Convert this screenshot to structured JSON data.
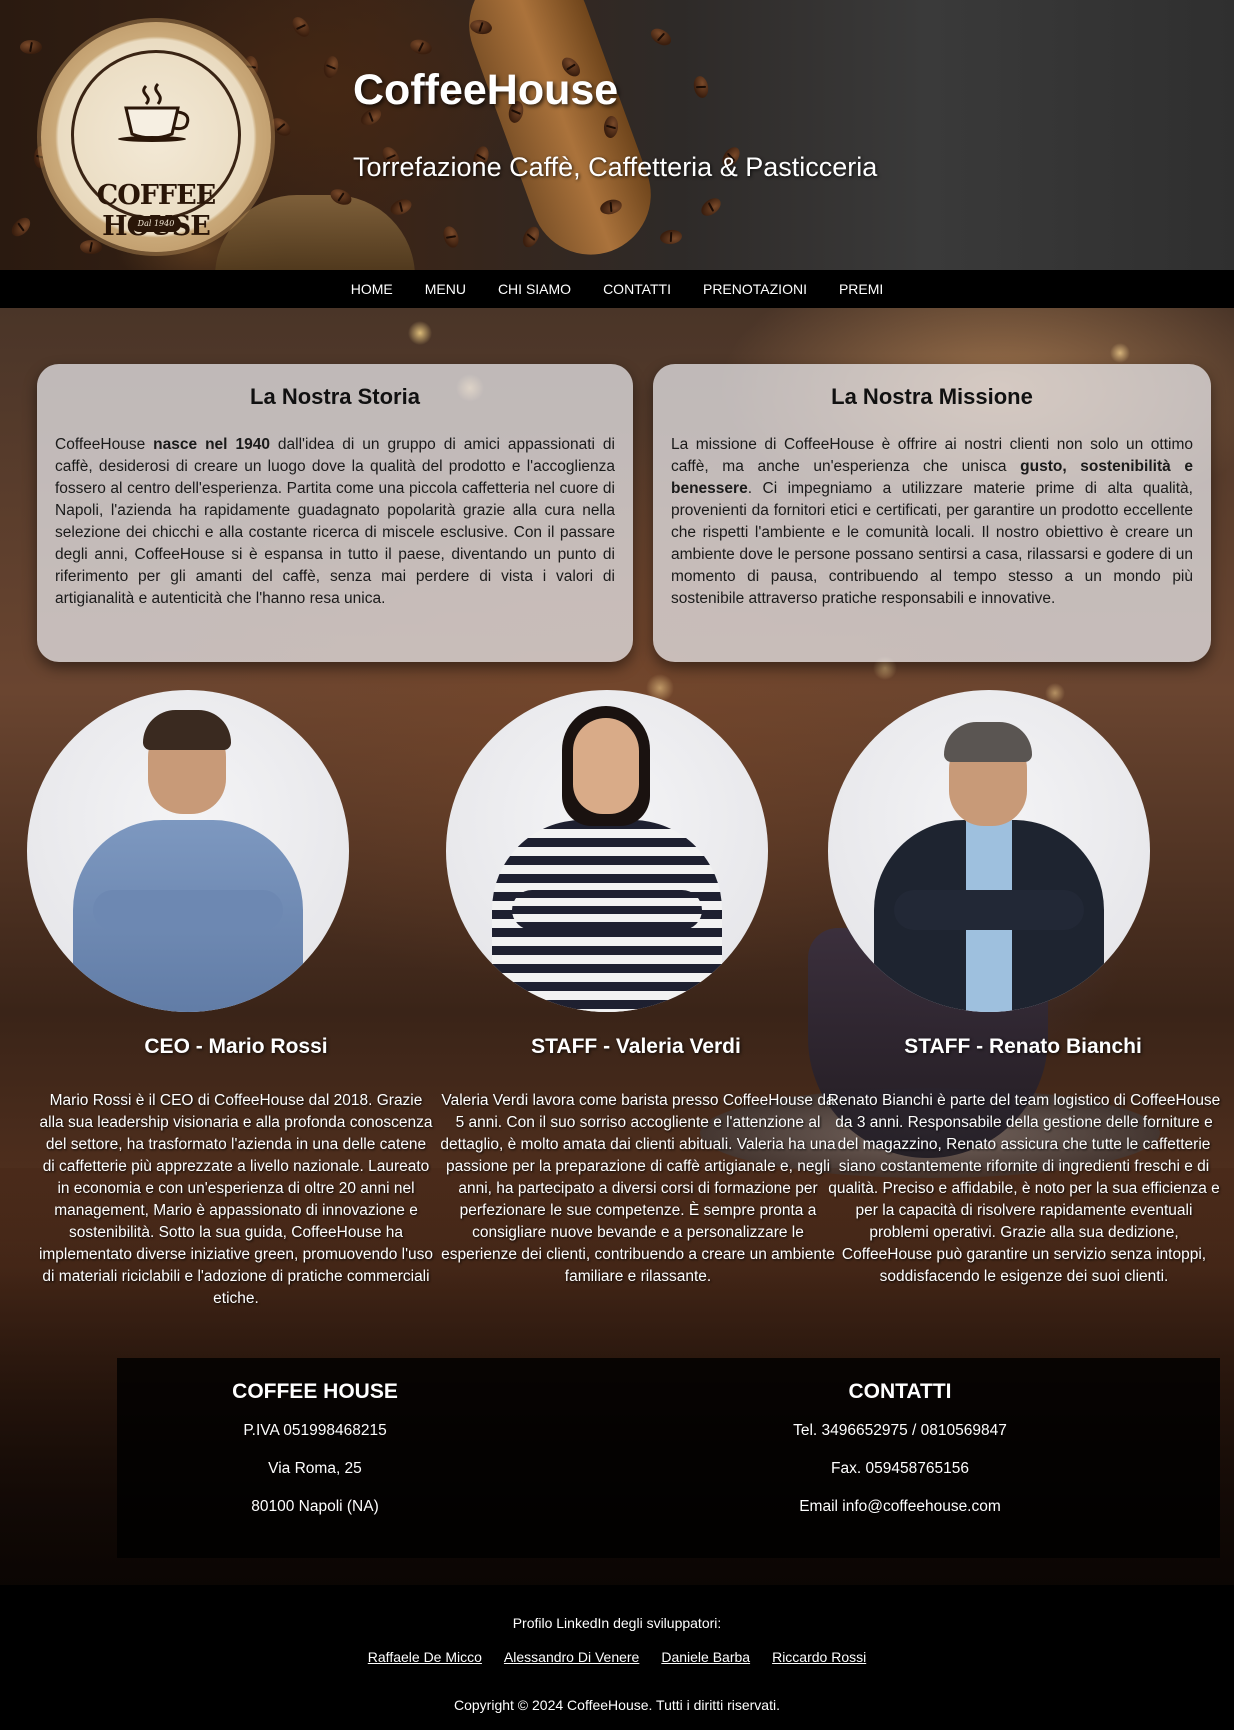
{
  "header": {
    "title": "CoffeeHouse",
    "subtitle": "Torrefazione Caffè, Caffetteria & Pasticceria",
    "logo_text": "COFFEE HOUSE",
    "logo_subtext": "Dal 1940"
  },
  "nav": {
    "items": [
      "HOME",
      "MENU",
      "CHI SIAMO",
      "CONTATTI",
      "PRENOTAZIONI",
      "PREMI"
    ]
  },
  "story": {
    "title": "La Nostra Storia",
    "text_before": "CoffeeHouse ",
    "text_bold": "nasce nel 1940",
    "text_after": " dall'idea di un gruppo di amici appassionati di caffè, desiderosi di creare un luogo dove la qualità del prodotto e l'accoglienza fossero al centro dell'esperienza. Partita come una piccola caffetteria nel cuore di Napoli, l'azienda ha rapidamente guadagnato popolarità grazie alla cura nella selezione dei chicchi e alla costante ricerca di miscele esclusive. Con il passare degli anni, CoffeeHouse si è espansa in tutto il paese, diventando un punto di riferimento per gli amanti del caffè, senza mai perdere di vista i valori di artigianalità e autenticità che l'hanno resa unica."
  },
  "mission": {
    "title": "La Nostra Missione",
    "text_before": "La missione di CoffeeHouse è offrire ai nostri clienti non solo un ottimo caffè, ma anche un'esperienza che unisca ",
    "text_bold": "gusto, sostenibilità e benessere",
    "text_after": ". Ci impegniamo a utilizzare materie prime di alta qualità, provenienti da fornitori etici e certificati, per garantire un prodotto eccellente che rispetti l'ambiente e le comunità locali. Il nostro obiettivo è creare un ambiente dove le persone possano sentirsi a casa, rilassarsi e godere di un momento di pausa, contribuendo al tempo stesso a un mondo più sostenibile attraverso pratiche responsabili e innovative."
  },
  "team": [
    {
      "name": "CEO - Mario Rossi",
      "description": "Mario Rossi è il CEO di CoffeeHouse dal 2018. Grazie alla sua leadership visionaria e alla profonda conoscenza del settore, ha trasformato l'azienda in una delle catene di caffetterie più apprezzate a livello nazionale. Laureato in economia e con un'esperienza di oltre 20 anni nel management, Mario è appassionato di innovazione e sostenibilità. Sotto la sua guida, CoffeeHouse ha implementato diverse iniziative green, promuovendo l'uso di materiali riciclabili e l'adozione di pratiche commerciali etiche."
    },
    {
      "name": "STAFF - Valeria Verdi",
      "description": "Valeria Verdi lavora come barista presso CoffeeHouse da 5 anni. Con il suo sorriso accogliente e l'attenzione al dettaglio, è molto amata dai clienti abituali. Valeria ha una passione per la preparazione di caffè artigianale e, negli anni, ha partecipato a diversi corsi di formazione per perfezionare le sue competenze. È sempre pronta a consigliare nuove bevande e a personalizzare le esperienze dei clienti, contribuendo a creare un ambiente familiare e rilassante."
    },
    {
      "name": "STAFF - Renato Bianchi",
      "description": "Renato Bianchi è parte del team logistico di CoffeeHouse da 3 anni. Responsabile della gestione delle forniture e del magazzino, Renato assicura che tutte le caffetterie siano costantemente rifornite di ingredienti freschi e di qualità. Preciso e affidabile, è noto per la sua efficienza e per la capacità di risolvere rapidamente eventuali problemi operativi. Grazie alla sua dedizione, CoffeeHouse può garantire un servizio senza intoppi, soddisfacendo le esigenze dei suoi clienti."
    }
  ],
  "company": {
    "title": "COFFEE HOUSE",
    "lines": [
      "P.IVA 051998468215",
      "Via Roma, 25",
      "80100 Napoli (NA)"
    ]
  },
  "contacts": {
    "title": "CONTATTI",
    "lines": [
      "Tel. 3496652975 / 0810569847",
      "Fax. 059458765156",
      "Email info@coffeehouse.com"
    ]
  },
  "footer": {
    "dev_label": "Profilo LinkedIn degli sviluppatori:",
    "developers": [
      "Raffaele De Micco",
      "Alessandro Di Venere",
      "Daniele Barba",
      "Riccardo Rossi"
    ],
    "copyright": "Copyright © 2024 CoffeeHouse. Tutti i diritti riservati."
  }
}
